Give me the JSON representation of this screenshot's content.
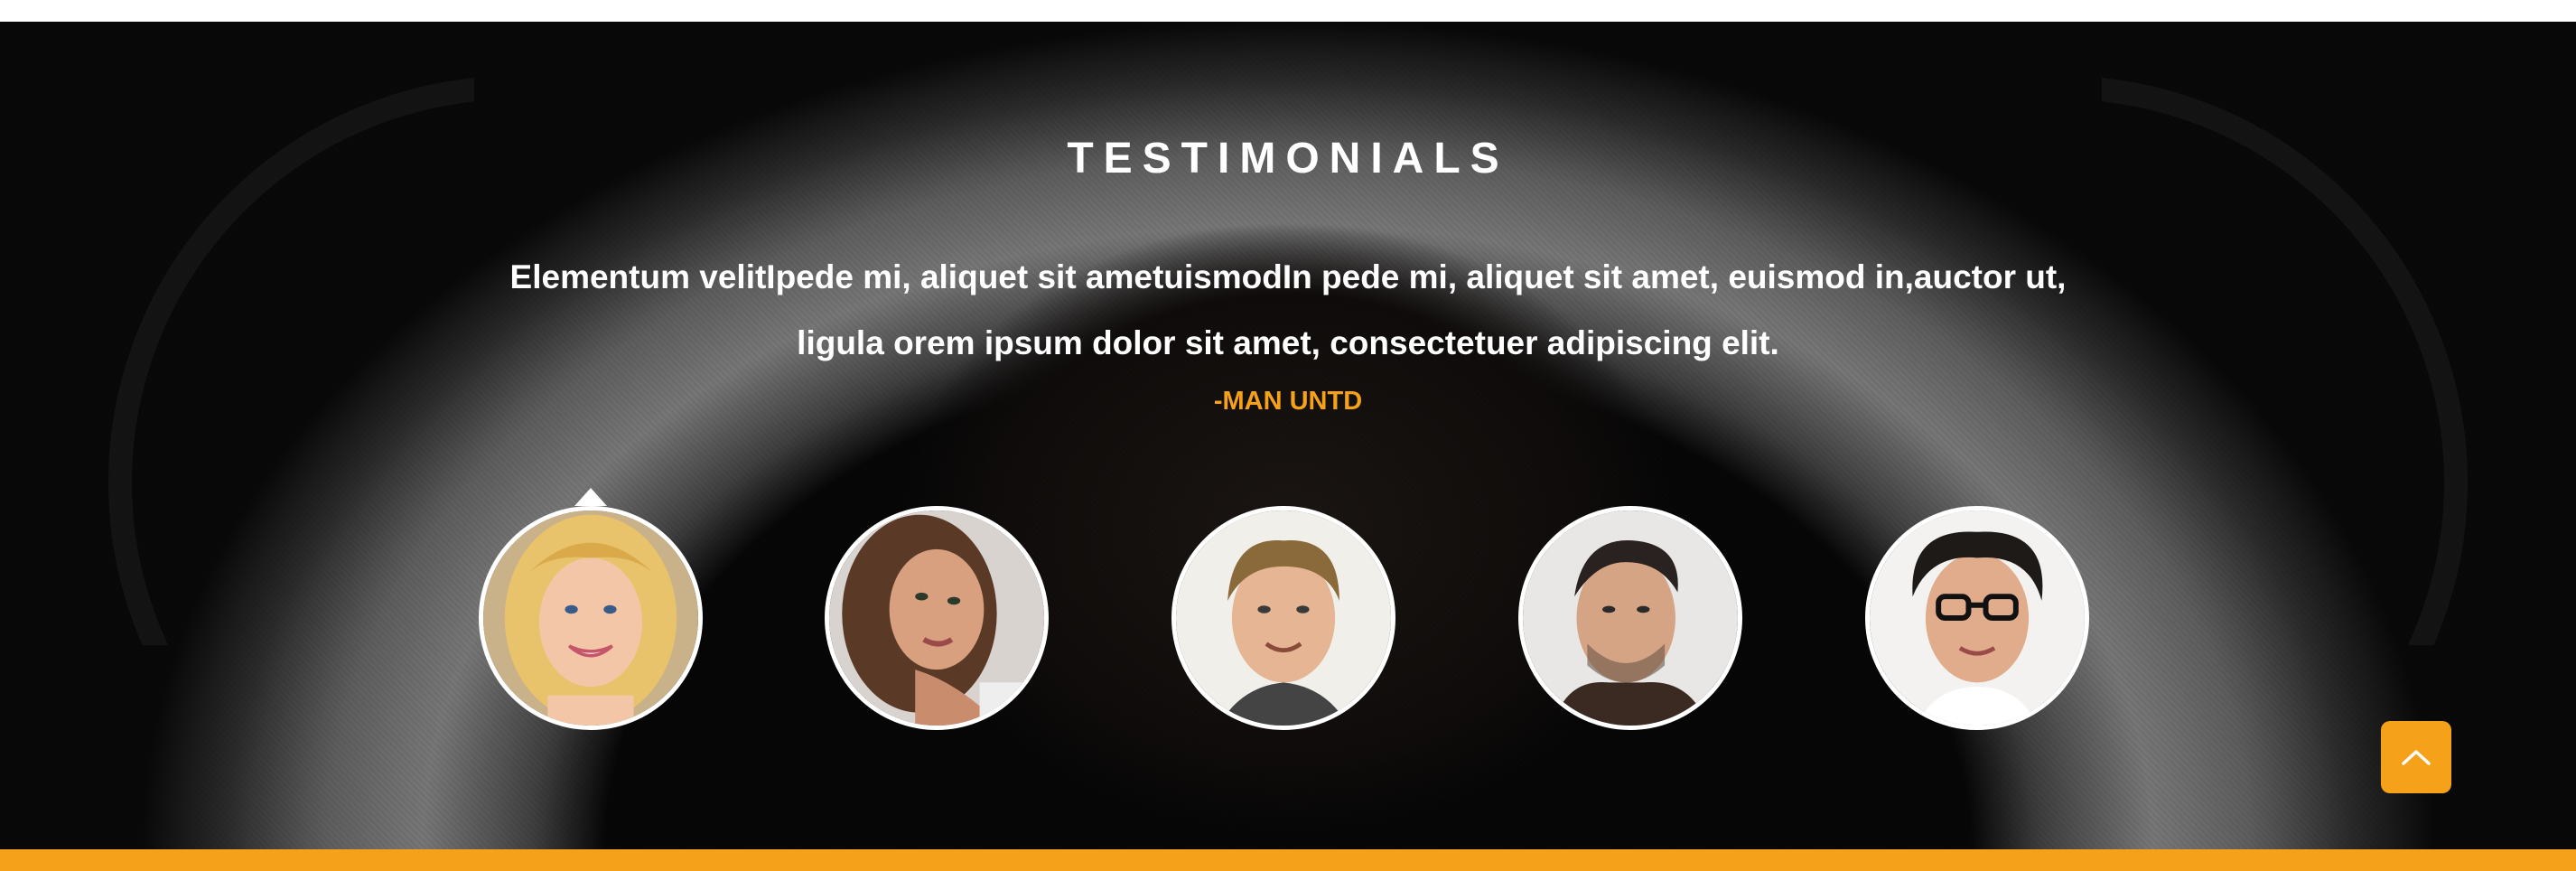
{
  "testimonials": {
    "title": "TESTIMONIALS",
    "quote_line1": "Elementum velitIpede mi, aliquet sit ametuismodIn pede mi, aliquet sit amet, euismod in,auctor ut,",
    "quote_line2": "ligula orem ipsum dolor sit amet, consectetuer adipiscing elit.",
    "author": "-MAN UNTD",
    "active_index": 0,
    "avatars": [
      {
        "icon": "avatar-blonde-woman"
      },
      {
        "icon": "avatar-brunette-woman"
      },
      {
        "icon": "avatar-young-man"
      },
      {
        "icon": "avatar-man-dark-hair"
      },
      {
        "icon": "avatar-man-glasses"
      }
    ]
  },
  "scroll_top": {
    "icon": "chevron-up-icon"
  },
  "colors": {
    "accent": "#f5a21a",
    "title_text": "#ffffff",
    "avatar_border": "#ffffff",
    "background": "#060606"
  }
}
